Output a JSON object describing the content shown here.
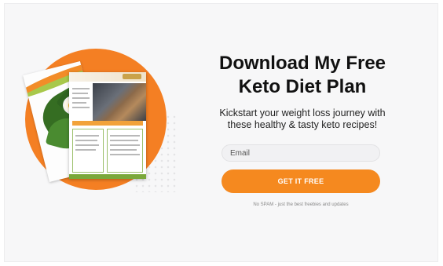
{
  "optin": {
    "title_line1": "Download My Free",
    "title_line2": "Keto Diet Plan",
    "subtitle_line1": "Kickstart your weight loss journey with",
    "subtitle_line2": "these healthy & tasty keto recipes!",
    "email_placeholder": "Email",
    "cta_label": "GET IT FREE",
    "disclaimer": "No SPAM - just the best freebies and updates"
  },
  "colors": {
    "accent": "#f5891f",
    "circle": "#f47f23",
    "background": "#f7f7f8"
  },
  "icons": {
    "mockup": "keto-plan-mockup-image"
  }
}
